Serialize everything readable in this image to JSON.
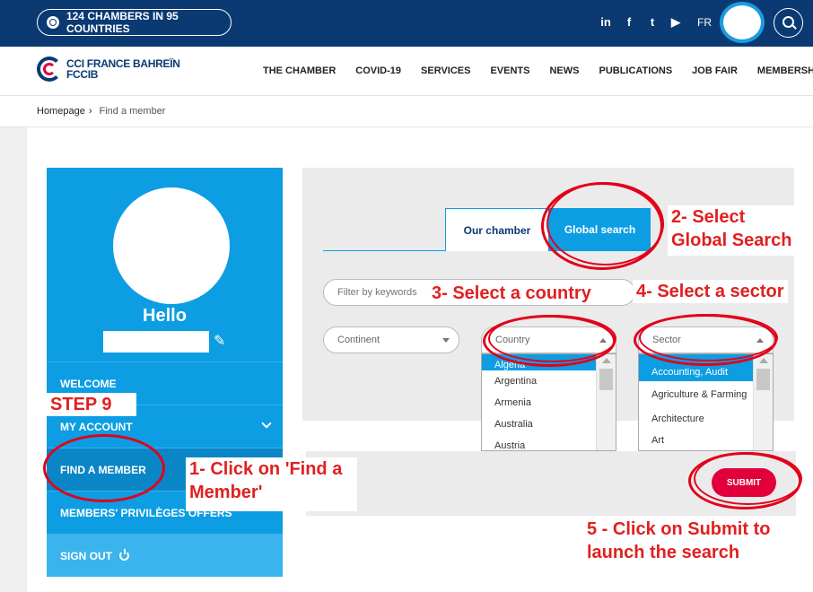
{
  "topbar": {
    "chambers_label": "124 CHAMBERS IN 95 COUNTRIES",
    "social_icons": [
      "linkedin-icon",
      "facebook-icon",
      "twitter-icon",
      "youtube-icon"
    ],
    "language": "FR"
  },
  "brand": {
    "line1": "CCI FRANCE BAHREÏN",
    "line2": "FCCIB"
  },
  "nav": {
    "items": [
      "THE CHAMBER",
      "COVID-19",
      "SERVICES",
      "EVENTS",
      "NEWS",
      "PUBLICATIONS",
      "JOB FAIR",
      "MEMBERSHIP"
    ]
  },
  "breadcrumb": {
    "home": "Homepage",
    "current": "Find a member"
  },
  "sidebar": {
    "greeting": "Hello",
    "items": [
      {
        "label": "WELCOME"
      },
      {
        "label": "MY ACCOUNT"
      },
      {
        "label": "FIND A MEMBER"
      },
      {
        "label": "MEMBERS' PRIVILÈGES OFFERS"
      },
      {
        "label": "SIGN OUT"
      }
    ]
  },
  "search": {
    "tabs": [
      "Our chamber",
      "Global search"
    ],
    "keywords_placeholder": "Filter by keywords",
    "continent_label": "Continent",
    "country_label": "Country",
    "sector_label": "Sector",
    "country_options": [
      "Algeria",
      "Argentina",
      "Armenia",
      "Australia",
      "Austria"
    ],
    "sector_options": [
      "Accounting, Audit",
      "Agriculture & Farming",
      "Architecture",
      "Art"
    ],
    "submit_label": "SUBMIT"
  },
  "annotations": {
    "step": "STEP 9",
    "n1_line1": "1- Click on 'Find a",
    "n1_line2": "Member'",
    "n2_line1": "2- Select",
    "n2_line2": "Global Search",
    "n3": "3- Select a country",
    "n4": "4- Select a sector",
    "n5_line1": "5 - Click on Submit to",
    "n5_line2": "launch the search",
    "color": "#e02020"
  },
  "colors": {
    "topbar": "#0b3a73",
    "accent": "#0d9de3",
    "submit": "#e2003b"
  }
}
